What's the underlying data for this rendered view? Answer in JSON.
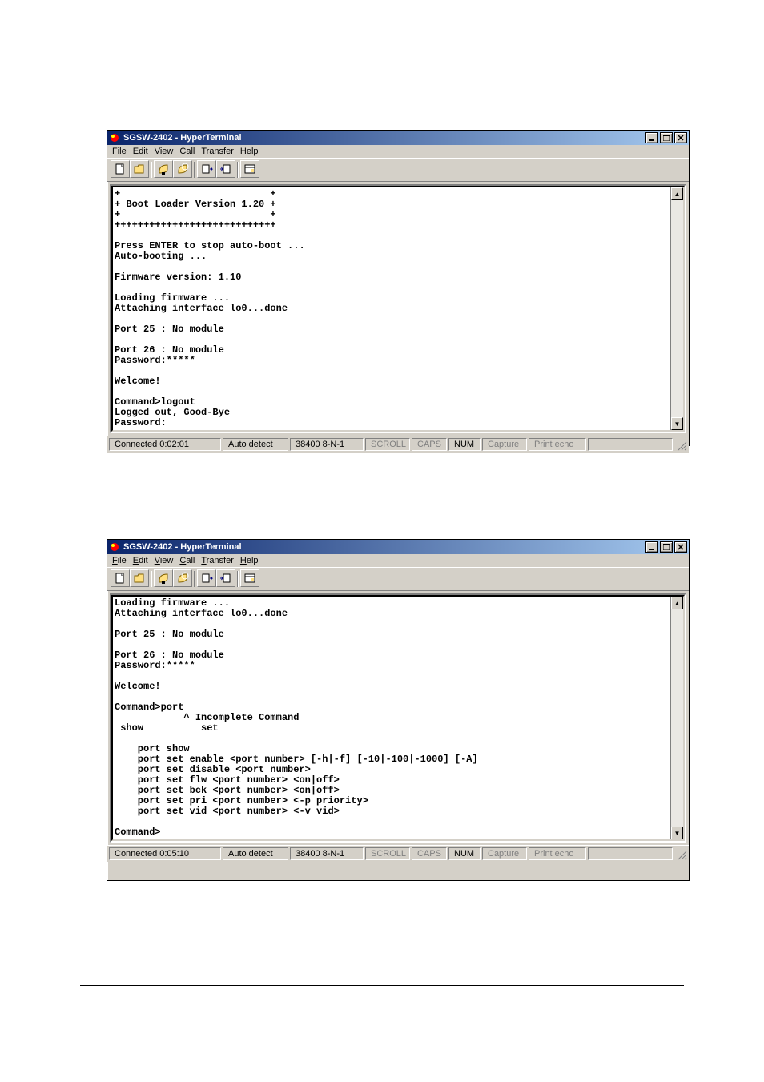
{
  "window1": {
    "title": "SGSW-2402 - HyperTerminal",
    "menu": {
      "file": "File",
      "edit": "Edit",
      "view": "View",
      "call": "Call",
      "transfer": "Transfer",
      "help": "Help"
    },
    "terminal": "+                          +\n+ Boot Loader Version 1.20 +\n+                          +\n++++++++++++++++++++++++++++\n\nPress ENTER to stop auto-boot ...\nAuto-booting ...\n\nFirmware version: 1.10\n\nLoading firmware ...\nAttaching interface lo0...done\n\nPort 25 : No module\n\nPort 26 : No module\nPassword:*****\n\nWelcome!\n\nCommand>logout\nLogged out, Good-Bye\nPassword:",
    "status": {
      "connected": "Connected 0:02:01",
      "autodetect": "Auto detect",
      "portset": "38400 8-N-1",
      "scroll": "SCROLL",
      "caps": "CAPS",
      "num": "NUM",
      "capture": "Capture",
      "printecho": "Print echo"
    }
  },
  "window2": {
    "title": "SGSW-2402 - HyperTerminal",
    "menu": {
      "file": "File",
      "edit": "Edit",
      "view": "View",
      "call": "Call",
      "transfer": "Transfer",
      "help": "Help"
    },
    "terminal": "Loading firmware ...\nAttaching interface lo0...done\n\nPort 25 : No module\n\nPort 26 : No module\nPassword:*****\n\nWelcome!\n\nCommand>port\n            ^ Incomplete Command\n show          set\n\n    port show\n    port set enable <port number> [-h|-f] [-10|-100|-1000] [-A]\n    port set disable <port number>\n    port set flw <port number> <on|off>\n    port set bck <port number> <on|off>\n    port set pri <port number> <-p priority>\n    port set vid <port number> <-v vid>\n\nCommand>",
    "status": {
      "connected": "Connected 0:05:10",
      "autodetect": "Auto detect",
      "portset": "38400 8-N-1",
      "scroll": "SCROLL",
      "caps": "CAPS",
      "num": "NUM",
      "capture": "Capture",
      "printecho": "Print echo"
    }
  }
}
